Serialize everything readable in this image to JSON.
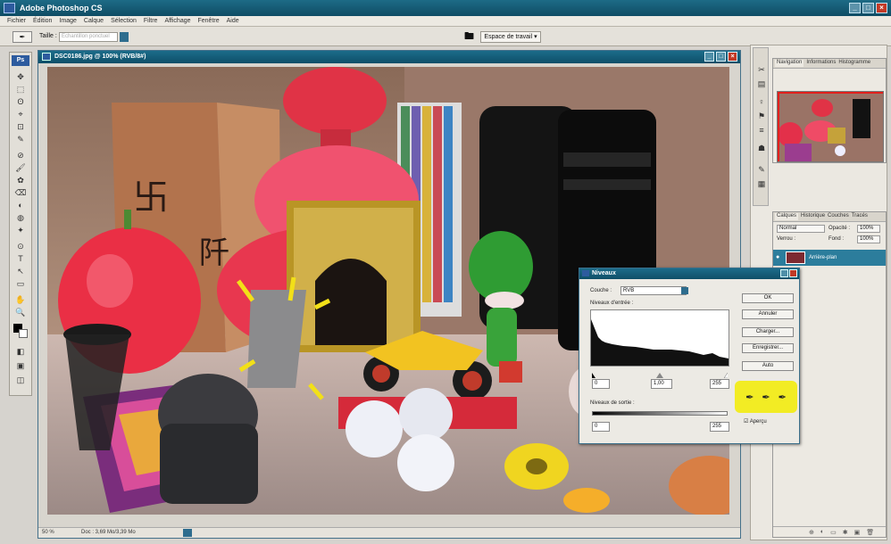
{
  "app": {
    "title": "Adobe Photoshop CS",
    "menu": [
      "Fichier",
      "Édition",
      "Image",
      "Calque",
      "Sélection",
      "Filtre",
      "Affichage",
      "Fenêtre",
      "Aide"
    ],
    "window_buttons": [
      "_",
      "□",
      "×"
    ]
  },
  "options": {
    "tool_glyph": "✒",
    "size_label": "Taille :",
    "size_placeholder": "Échantillon ponctuel",
    "workspace_label": "Espace de travail ▾"
  },
  "toolbox": {
    "logo": "Ps",
    "tools": [
      "✥",
      "⬚",
      "ʘ",
      "⌖",
      "⊡",
      "✎",
      "⊘",
      "🖌",
      "✿",
      "⌫",
      "◐",
      "◍",
      "✦",
      "⊙",
      "T",
      "↖",
      "▭",
      "✋",
      "🔍",
      "◧",
      "▣",
      "◫"
    ]
  },
  "document": {
    "title": "DSC0186.jpg @ 100% (RVB/8#)",
    "zoom": "50 %",
    "doc_info": "Doc : 3,69 Mo/3,39 Mo"
  },
  "panels": {
    "strip_icons": [
      "✂",
      "▤",
      "♀",
      "⚑",
      "≡",
      "☗",
      "✎",
      "▦"
    ],
    "navigator_tabs": [
      "Navigation",
      "Informations",
      "Histogramme"
    ],
    "layers_tabs": [
      "Calques",
      "Historique",
      "Couches",
      "Tracés"
    ],
    "blend_mode": "Normal",
    "opacity_label": "Opacité :",
    "opacity_value": "100%",
    "lock_label": "Verrou :",
    "fill_label": "Fond :",
    "fill_value": "100%",
    "layer_name": "Arrière-plan",
    "footer_icons": [
      "⊕",
      "◐",
      "▭",
      "✱",
      "▣",
      "🗑"
    ]
  },
  "levels": {
    "title": "Niveaux",
    "channel_label": "Couche :",
    "channel_value": "RVB",
    "input_label": "Niveaux d'entrée :",
    "input_black": "0",
    "input_gamma": "1,00",
    "input_white": "255",
    "output_label": "Niveaux de sortie :",
    "output_black": "0",
    "output_white": "255",
    "buttons": [
      "OK",
      "Annuler",
      "Charger...",
      "Enregistrer...",
      "Auto",
      "Options..."
    ],
    "preview_label": "Aperçu",
    "eyedroppers": [
      "✒",
      "✒",
      "✒"
    ]
  },
  "colors": {
    "titlebar": "#0f4c64",
    "highlight": "#f2ec24",
    "selected_layer": "#2c7d9c"
  }
}
